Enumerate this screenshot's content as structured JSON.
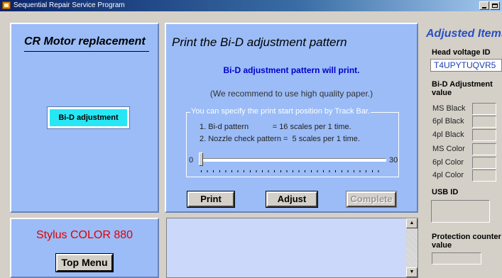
{
  "window": {
    "title": "Sequential Repair Service Program"
  },
  "left_panel": {
    "heading": "CR Motor replacement",
    "bid_button": "Bi-D adjustment"
  },
  "model_panel": {
    "model_name": "Stylus COLOR 880",
    "top_menu_button": "Top Menu"
  },
  "center_panel": {
    "title": "Print the Bi-D adjustment pattern",
    "subtitle": "Bi-D adjustment pattern will print.",
    "recommendation": "(We recommend to use high quality paper.)",
    "trackbar_group": {
      "legend": "You can specify the print start position by Track Bar.",
      "line1": "1. Bi-d pattern           = 16 scales per 1 time.",
      "line2": "2. Nozzle check pattern =  5 scales per 1 time.",
      "min_label": "0",
      "max_label": "30",
      "value": 0
    },
    "buttons": {
      "print": "Print",
      "adjust": "Adjust",
      "complete": "Complete"
    }
  },
  "right_panel": {
    "title": "Adjusted Items",
    "head_voltage_label": "Head voltage ID",
    "head_voltage_value": "T4UPYTUQVR5",
    "bid_label_line1": "Bi-D Adjustment",
    "bid_label_line2": "value",
    "adjustment_rows": [
      {
        "label": "MS Black",
        "value": ""
      },
      {
        "label": "6pl Black",
        "value": ""
      },
      {
        "label": "4pl Black",
        "value": ""
      },
      {
        "label": "MS Color",
        "value": ""
      },
      {
        "label": "6pl Color",
        "value": ""
      },
      {
        "label": "4pl Color",
        "value": ""
      }
    ],
    "usb_label": "USB ID",
    "protection_label_line1": "Protection counter",
    "protection_label_line2": "value"
  }
}
